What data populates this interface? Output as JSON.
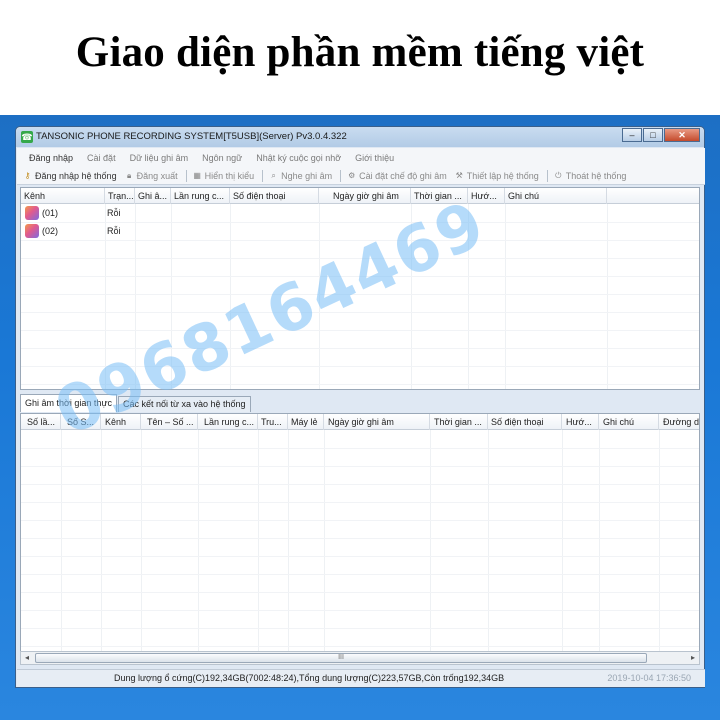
{
  "headline": "Giao diện phần mềm tiếng việt",
  "window": {
    "title": "TANSONIC PHONE RECORDING SYSTEM[T5USB](Server) Pv3.0.4.322"
  },
  "menu": [
    "Đăng nhập",
    "Cài đặt",
    "Dữ liệu ghi âm",
    "Ngôn ngữ",
    "Nhật ký cuộc gọi nhỡ",
    "Giới thiệu"
  ],
  "toolbar": {
    "login": "Đăng nhập hệ thống",
    "logout": "Đăng xuất",
    "display": "Hiển thị kiểu",
    "listen": "Nghe ghi âm",
    "record_mode": "Cài đặt chế độ ghi âm",
    "setup": "Thiết lập hệ thống",
    "exit": "Thoát hệ thống"
  },
  "channels_table": {
    "headers": [
      "Kênh",
      "Trạn...",
      "Ghi â...",
      "Lần rung c...",
      "Số điện thoại",
      "Ngày giờ ghi âm",
      "Thời gian ...",
      "Hướ...",
      "Ghi chú"
    ],
    "rows": [
      {
        "channel": "(01)",
        "status": "Rỗi"
      },
      {
        "channel": "(02)",
        "status": "Rỗi"
      }
    ]
  },
  "tabs": [
    "Ghi âm thời gian thực",
    "Các kết nối từ xa vào hệ thống"
  ],
  "records_table": {
    "headers": [
      "Số lầ...",
      "Số S...",
      "Kênh",
      "Tên – Số ...",
      "Lần rung c...",
      "Tru...",
      "Máy lẻ",
      "Ngày giờ ghi âm",
      "Thời gian ...",
      "Số điện thoại",
      "Hướ...",
      "Ghi chú",
      "Đường d"
    ]
  },
  "scrollbar": {
    "grip": "III"
  },
  "status": {
    "disk": "Dung lượng ổ cứng(C)192,34GB(7002:48:24),Tổng dung lượng(C)223,57GB,Còn trống192,34GB",
    "datetime": "2019-10-04 17:36:50"
  },
  "watermark": "0968164469"
}
